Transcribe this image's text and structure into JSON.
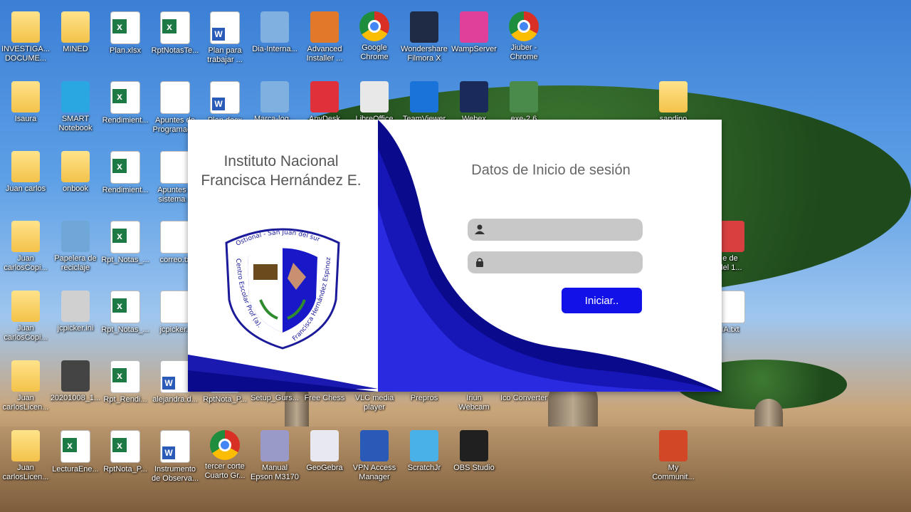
{
  "desktop": {
    "icons": [
      {
        "label": "INVESTIGA...\nDOCUME...",
        "icon": "folder-icon"
      },
      {
        "label": "MINED",
        "icon": "folder-icon"
      },
      {
        "label": "Plan.xlsx",
        "icon": "excel-icon"
      },
      {
        "label": "RptNotasTe...",
        "icon": "excel-icon"
      },
      {
        "label": "Plan para\ntrabajar ...",
        "icon": "word-icon"
      },
      {
        "label": "Dia-Interna...",
        "icon": "image-icon"
      },
      {
        "label": "Advanced\nInstaller ...",
        "icon": "installer-icon"
      },
      {
        "label": "Google\nChrome",
        "icon": "chrome-icon"
      },
      {
        "label": "Wondershare\nFilmora X",
        "icon": "filmora-icon"
      },
      {
        "label": "WampServer",
        "icon": "wamp-icon"
      },
      {
        "label": "Jiuber -\nChrome",
        "icon": "chrome-icon"
      },
      {
        "label": "Isaura",
        "icon": "folder-icon"
      },
      {
        "label": "SMART\nNotebook",
        "icon": "smart-notebook-icon"
      },
      {
        "label": "Rendimient...",
        "icon": "excel-icon"
      },
      {
        "label": "Apuntes de\nProgramac...",
        "icon": "document-icon"
      },
      {
        "label": "Plan.docx",
        "icon": "word-icon"
      },
      {
        "label": "Marca-log...",
        "icon": "image-icon"
      },
      {
        "label": "AnyDesk",
        "icon": "anydesk-icon"
      },
      {
        "label": "LibreOffice",
        "icon": "libreoffice-icon"
      },
      {
        "label": "TeamViewer",
        "icon": "teamviewer-icon"
      },
      {
        "label": "Webex",
        "icon": "webex-icon"
      },
      {
        "label": "exe-2.6",
        "icon": "exe-icon"
      },
      {
        "label": "sandino",
        "icon": "folder-icon"
      },
      {
        "label": "Juan carlos",
        "icon": "folder-icon"
      },
      {
        "label": "onbook",
        "icon": "folder-icon"
      },
      {
        "label": "Rendimient...",
        "icon": "excel-icon"
      },
      {
        "label": "Apuntes d\nsistema a",
        "icon": "document-icon"
      },
      {
        "label": "Juan\ncarlosCopi...",
        "icon": "folder-icon"
      },
      {
        "label": "Papelera de\nreciclaje",
        "icon": "recycle-bin-icon"
      },
      {
        "label": "Rpt_Notas_...",
        "icon": "excel-icon"
      },
      {
        "label": "correo.tx",
        "icon": "document-icon"
      },
      {
        "label": "e de\ndel 1...",
        "icon": "pdf-icon"
      },
      {
        "label": "Juan\ncarlosCopi...",
        "icon": "folder-icon"
      },
      {
        "label": "jcpicker.ini",
        "icon": "settings-file-icon"
      },
      {
        "label": "Rpt_Notas_...",
        "icon": "excel-icon"
      },
      {
        "label": "jcpicker.t",
        "icon": "document-icon"
      },
      {
        "label": "IA.txt",
        "icon": "document-icon"
      },
      {
        "label": "Juan\ncarlosLicen...",
        "icon": "folder-icon"
      },
      {
        "label": "20201008_1...",
        "icon": "video-icon"
      },
      {
        "label": "Rpt_Rendi...",
        "icon": "excel-icon"
      },
      {
        "label": "alejandra.d...",
        "icon": "word-icon"
      },
      {
        "label": "RptNota_P...",
        "icon": "excel-icon"
      },
      {
        "label": "Setup_Gurs...",
        "icon": "installer-icon"
      },
      {
        "label": "Free Chess",
        "icon": "chess-icon"
      },
      {
        "label": "VLC media\nplayer",
        "icon": "vlc-icon"
      },
      {
        "label": "Prepros",
        "icon": "prepros-icon"
      },
      {
        "label": "Iriun\nWebcam",
        "icon": "webcam-icon"
      },
      {
        "label": "Ico Converter",
        "icon": "converter-icon"
      },
      {
        "label": "Juan\ncarlosLicen...",
        "icon": "folder-icon"
      },
      {
        "label": "LecturaEne...",
        "icon": "excel-icon"
      },
      {
        "label": "RptNota_P...",
        "icon": "excel-icon"
      },
      {
        "label": "Instrumento\nde Observa...",
        "icon": "word-icon"
      },
      {
        "label": "tercer corte\nCuarto Gr...",
        "icon": "chrome-icon"
      },
      {
        "label": "Manual\nEpson M3170",
        "icon": "manual-icon"
      },
      {
        "label": "GeoGebra",
        "icon": "geogebra-icon"
      },
      {
        "label": "VPN Access\nManager",
        "icon": "vpn-icon"
      },
      {
        "label": "ScratchJr",
        "icon": "scratchjr-icon"
      },
      {
        "label": "OBS Studio",
        "icon": "obs-icon"
      },
      {
        "label": "My\nCommunit...",
        "icon": "powerpoint-icon"
      }
    ]
  },
  "login": {
    "school_name_line1": "Instituto Nacional",
    "school_name_line2": "Francisca Hernández E.",
    "title": "Datos de Inicio de sesión",
    "username_value": "",
    "password_value": "",
    "button_label": "Iniciar..",
    "crest": {
      "top_text": "Ostional - San Juan del sur",
      "left_text": "Centro Escolar Prof (a).",
      "right_text": "Francisca Hernández Espinoza"
    },
    "colors": {
      "accent": "#1212e8",
      "wave_dark": "#0a0a8c",
      "field_bg": "#c8c8c8"
    }
  }
}
